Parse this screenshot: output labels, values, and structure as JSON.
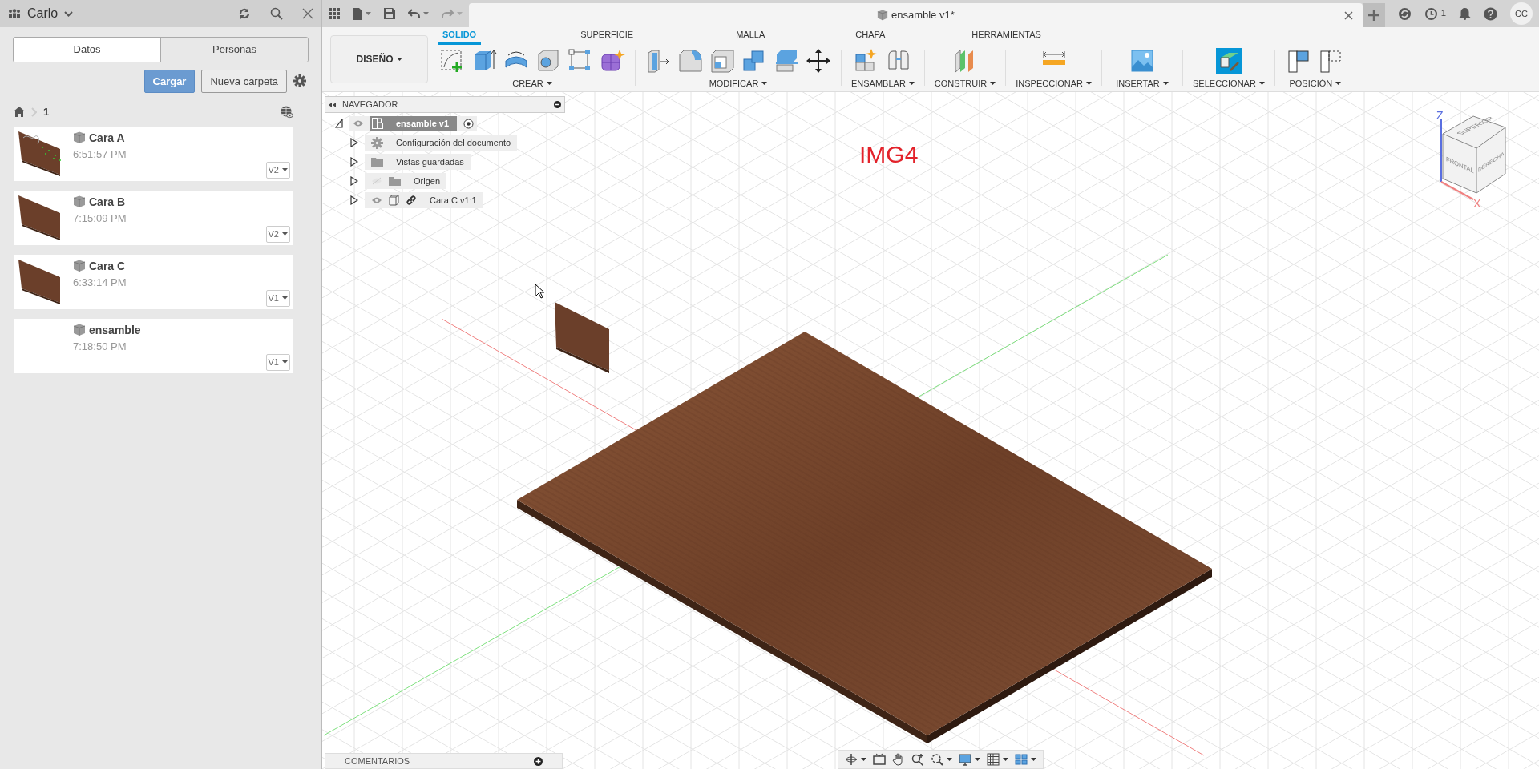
{
  "data_panel": {
    "team": "Carlo",
    "tabs": [
      {
        "label": "Datos",
        "selected": true
      },
      {
        "label": "Personas",
        "selected": false
      }
    ],
    "upload_button": "Cargar",
    "new_folder_button": "Nueva carpeta",
    "breadcrumb": "1",
    "files": [
      {
        "name": "Cara A",
        "time": "6:51:57 PM",
        "version": "V2",
        "kind": "sketched"
      },
      {
        "name": "Cara B",
        "time": "7:15:09 PM",
        "version": "V2",
        "kind": "panel"
      },
      {
        "name": "Cara C",
        "time": "6:33:14 PM",
        "version": "V1",
        "kind": "panel"
      },
      {
        "name": "ensamble",
        "time": "7:18:50 PM",
        "version": "V1",
        "kind": "blank"
      }
    ]
  },
  "document_tab": {
    "title": "ensamble v1*"
  },
  "jobs_count": "1",
  "avatar": "CC",
  "workspace": "DISEÑO",
  "ribbon_tabs": [
    {
      "label": "SOLIDO",
      "selected": true
    },
    {
      "label": "SUPERFICIE",
      "selected": false
    },
    {
      "label": "MALLA",
      "selected": false
    },
    {
      "label": "CHAPA",
      "selected": false
    },
    {
      "label": "HERRAMIENTAS",
      "selected": false
    }
  ],
  "tool_groups": [
    {
      "label": "CREAR"
    },
    {
      "label": "MODIFICAR"
    },
    {
      "label": "ENSAMBLAR"
    },
    {
      "label": "CONSTRUIR"
    },
    {
      "label": "INSPECCIONAR"
    },
    {
      "label": "INSERTAR"
    },
    {
      "label": "SELECCIONAR"
    },
    {
      "label": "POSICIÓN"
    }
  ],
  "navigator": {
    "title": "NAVEGADOR",
    "root": {
      "label": "ensamble v1",
      "visible": true,
      "expanded": true,
      "children": [
        {
          "label": "Configuración del documento",
          "kind": "settings",
          "expanded": false
        },
        {
          "label": "Vistas guardadas",
          "kind": "folder",
          "expanded": false
        },
        {
          "label": "Origen",
          "kind": "folder",
          "visible": false,
          "expanded": false
        },
        {
          "label": "Cara C v1:1",
          "kind": "component",
          "visible": true,
          "expanded": false
        }
      ]
    }
  },
  "viewport": {
    "annotation": "IMG4",
    "view_cube": {
      "faces": [
        "SUPERIOR",
        "FRONTAL",
        "DERECHA"
      ],
      "axes": [
        "Z",
        "X"
      ]
    }
  },
  "comments": {
    "title": "COMENTARIOS"
  }
}
